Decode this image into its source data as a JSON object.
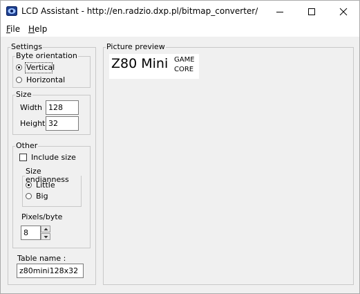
{
  "window": {
    "title": "LCD Assistant -  http://en.radzio.dxp.pl/bitmap_converter/",
    "icons": {
      "app": "lcd-assistant-app-icon",
      "minimize": "minimize-icon",
      "maximize": "maximize-icon",
      "close": "close-icon"
    }
  },
  "menu": {
    "file": {
      "mnemonic": "F",
      "rest": "ile"
    },
    "help": {
      "mnemonic": "H",
      "rest": "elp"
    }
  },
  "settings": {
    "legend": "Settings",
    "byte_orientation": {
      "legend": "Byte orientation",
      "vertical": "Vertical",
      "horizontal": "Horizontal",
      "selected": "Vertical"
    },
    "size": {
      "legend": "Size",
      "width_label": "Width",
      "width_value": "128",
      "height_label": "Height",
      "height_value": "32"
    },
    "other": {
      "legend": "Other",
      "include_size_label": "Include size",
      "include_size_checked": false,
      "endianness": {
        "legend": "Size endianness",
        "little": "Little",
        "big": "Big",
        "selected": "Little"
      },
      "pixels_per_byte_label": "Pixels/byte",
      "pixels_per_byte_value": "8"
    },
    "table_name_label": "Table name :",
    "table_name_value": "z80mini128x32"
  },
  "preview": {
    "legend": "Picture preview",
    "image": {
      "main_text": "Z80 Mini",
      "sub_text_1": "GAME",
      "sub_text_2": "CORE"
    }
  }
}
